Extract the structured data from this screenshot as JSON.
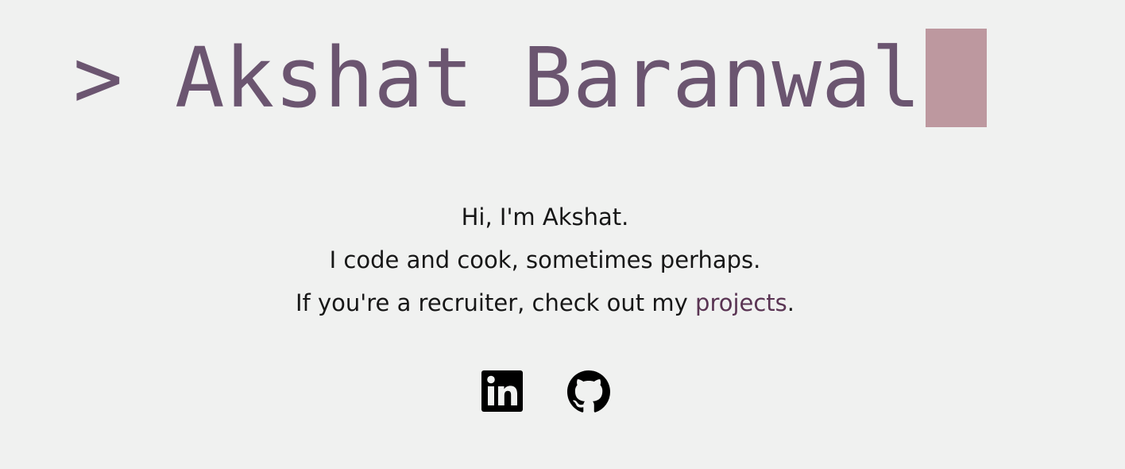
{
  "hero": {
    "prompt_symbol": ">",
    "name": "Akshat Baranwal"
  },
  "intro": {
    "line1": "Hi, I'm Akshat.",
    "line2": "I code and cook, sometimes perhaps.",
    "line3_prefix": "If you're a recruiter, check out my",
    "line3_link": "projects",
    "line3_suffix": "."
  },
  "social": {
    "linkedin_icon": "linkedin-icon",
    "github_icon": "github-icon"
  },
  "colors": {
    "background": "#f0f1f0",
    "heading": "#6b5570",
    "cursor": "#bd989f",
    "link": "#5a3453",
    "text": "#171717"
  }
}
